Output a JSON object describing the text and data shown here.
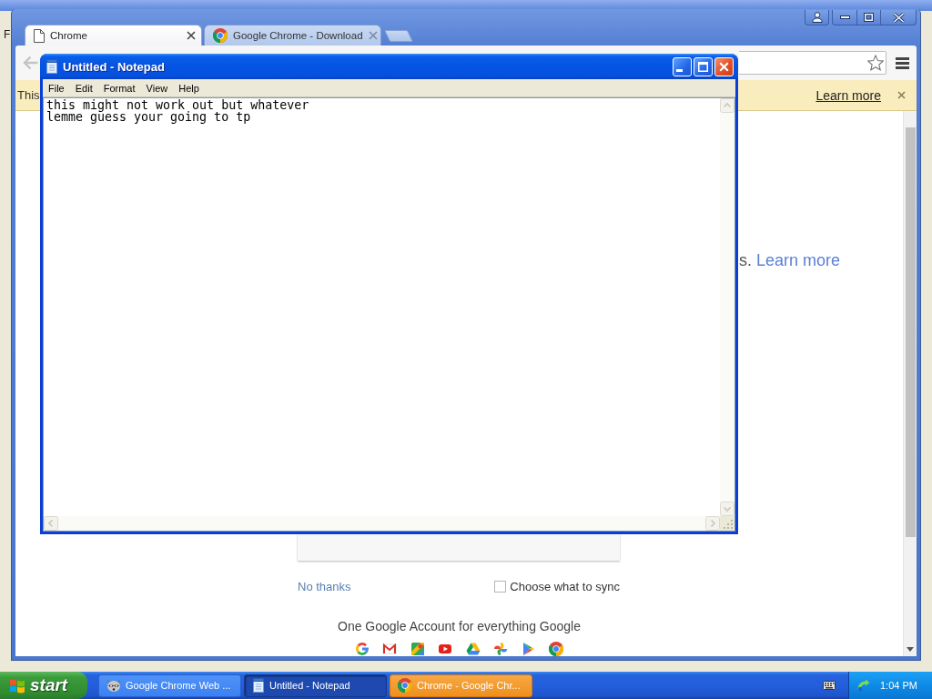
{
  "background_window": {
    "menu_fragment": "F"
  },
  "chrome": {
    "tabs": [
      {
        "title": "Chrome",
        "selected": true
      },
      {
        "title": "Google Chrome - Download",
        "selected": false
      }
    ],
    "infobar": {
      "text": "This",
      "link": "Learn more"
    },
    "content": {
      "text": "s.",
      "link": "Learn more",
      "no_thanks": "No thanks",
      "sync": {
        "label": "Choose what to sync",
        "checked": false
      },
      "tagline": "One Google Account for everything Google"
    }
  },
  "notepad": {
    "title": "Untitled - Notepad",
    "menu": [
      "File",
      "Edit",
      "Format",
      "View",
      "Help"
    ],
    "lines": [
      "this might not work out but whatever",
      "lemme guess your going to tp"
    ]
  },
  "taskbar": {
    "start": "start",
    "buttons": [
      {
        "label": "Google Chrome Web ...",
        "selected": false,
        "flashing": false
      },
      {
        "label": "Untitled - Notepad",
        "selected": true,
        "flashing": false
      },
      {
        "label": "Chrome - Google Chr...",
        "selected": false,
        "flashing": true
      }
    ],
    "clock": "1:04 PM"
  }
}
